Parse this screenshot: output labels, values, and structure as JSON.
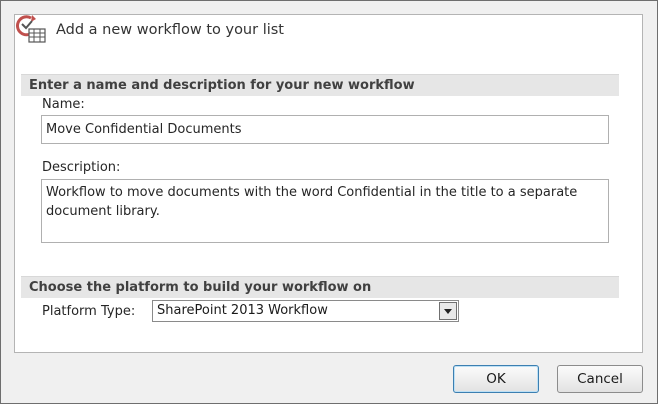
{
  "dialog": {
    "title": "Add a new workflow to your list",
    "icon": "workflow-icon"
  },
  "section_name": {
    "heading": "Enter a name and description for your new workflow"
  },
  "name_field": {
    "label": "Name:",
    "value": "Move Confidential Documents"
  },
  "description_field": {
    "label": "Description:",
    "value": "Workflow to move documents with the word Confidential in the title to a separate\ndocument library."
  },
  "section_platform": {
    "heading": "Choose the platform to build your workflow on"
  },
  "platform": {
    "label": "Platform Type:",
    "selected": "SharePoint 2013 Workflow"
  },
  "buttons": {
    "ok": "OK",
    "cancel": "Cancel"
  }
}
